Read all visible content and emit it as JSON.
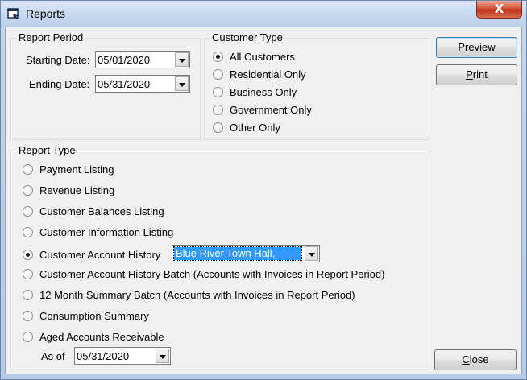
{
  "window": {
    "title": "Reports",
    "close_glyph": "X"
  },
  "report_period": {
    "legend": "Report Period",
    "starting_label": "Starting Date:",
    "starting_value": "05/01/2020",
    "ending_label": "Ending Date:",
    "ending_value": "05/31/2020"
  },
  "customer_type": {
    "legend": "Customer Type",
    "options": [
      {
        "label": "All Customers",
        "selected": true
      },
      {
        "label": "Residential Only",
        "selected": false
      },
      {
        "label": "Business Only",
        "selected": false
      },
      {
        "label": "Government Only",
        "selected": false
      },
      {
        "label": "Other Only",
        "selected": false
      }
    ]
  },
  "report_type": {
    "legend": "Report Type",
    "options": [
      {
        "label": "Payment Listing",
        "selected": false
      },
      {
        "label": "Revenue Listing",
        "selected": false
      },
      {
        "label": "Customer Balances Listing",
        "selected": false
      },
      {
        "label": "Customer Information Listing",
        "selected": false
      },
      {
        "label": "Customer Account History",
        "selected": true
      },
      {
        "label": "Customer Account History Batch (Accounts with Invoices in Report Period)",
        "selected": false
      },
      {
        "label": "12 Month Summary Batch (Accounts with Invoices in Report Period)",
        "selected": false
      },
      {
        "label": "Consumption Summary",
        "selected": false
      },
      {
        "label": "Aged Accounts Receivable",
        "selected": false
      }
    ],
    "account_combo_value": "Blue River Town Hall,",
    "as_of_label": "As of",
    "as_of_value": "05/31/2020"
  },
  "buttons": {
    "preview_access": "P",
    "preview_rest": "review",
    "print_access": "P",
    "print_rest": "rint",
    "close_access": "C",
    "close_rest": "lose"
  },
  "icons": {
    "title_icon": "reports-window-icon",
    "combo_arrow": "chevron-down-icon",
    "close": "close-icon"
  }
}
